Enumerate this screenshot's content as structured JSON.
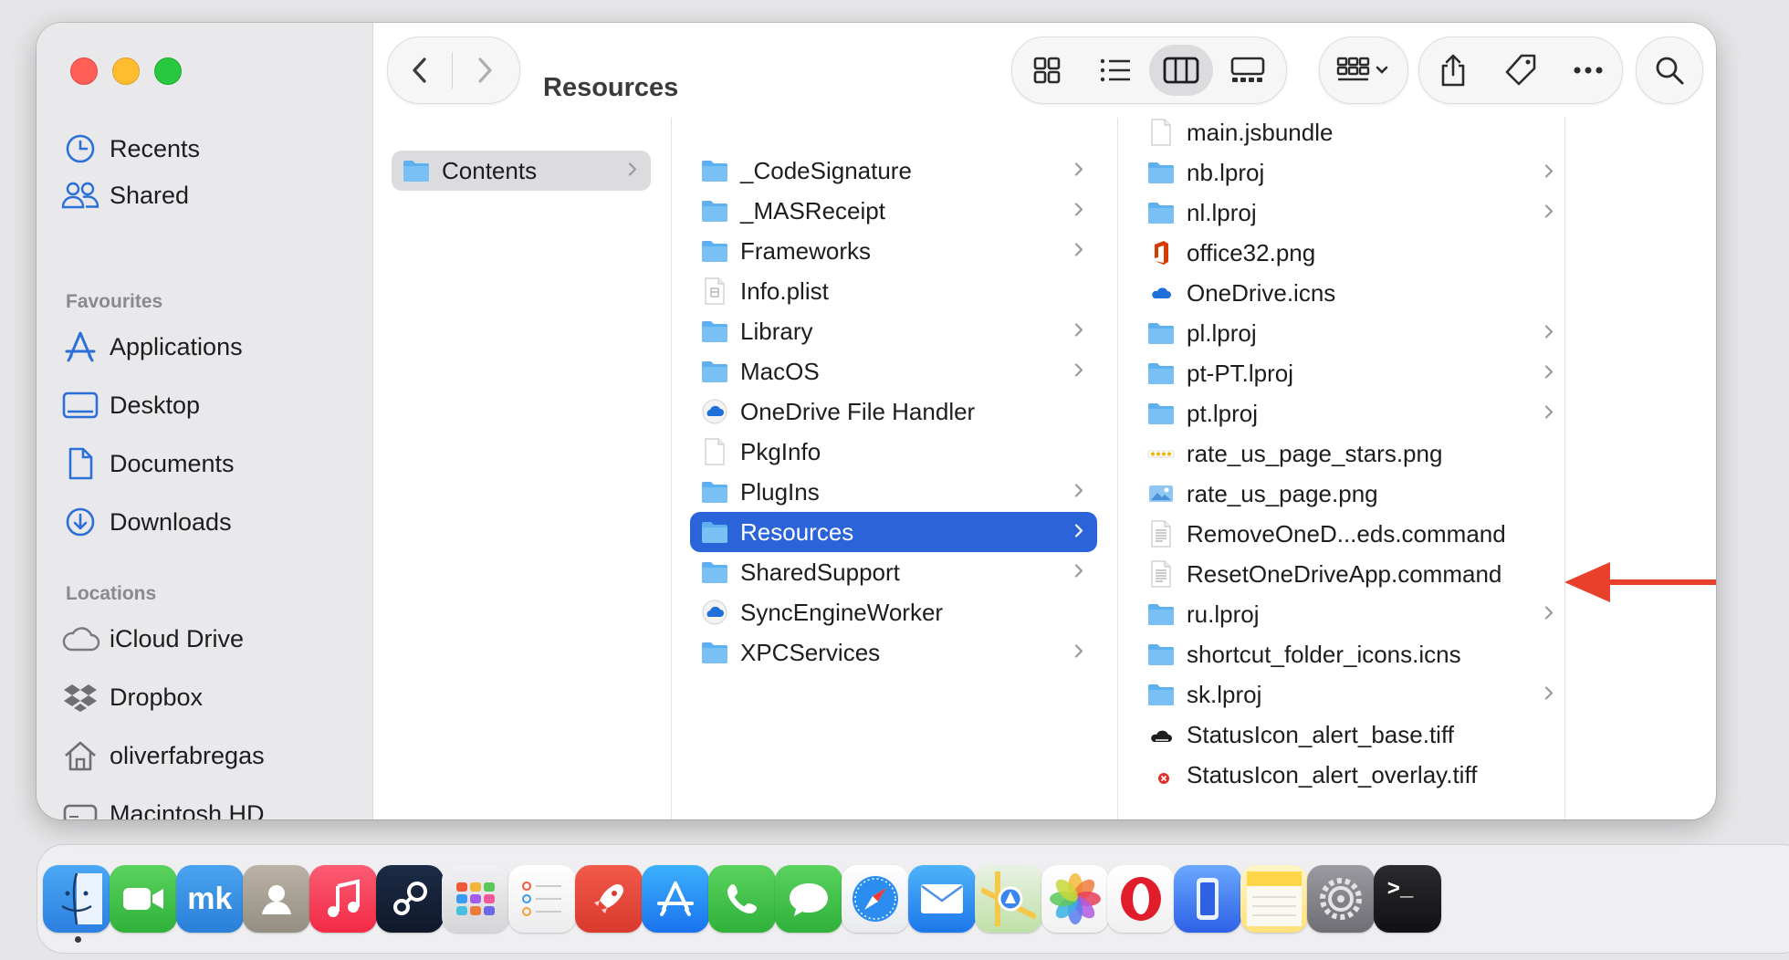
{
  "window": {
    "title": "Resources"
  },
  "sidebar": {
    "top_items": [
      {
        "label": "Recents",
        "icon": "clock-icon"
      },
      {
        "label": "Shared",
        "icon": "people-icon"
      }
    ],
    "favourites_heading": "Favourites",
    "favourites": [
      {
        "label": "Applications",
        "icon": "applications-icon"
      },
      {
        "label": "Desktop",
        "icon": "desktop-icon"
      },
      {
        "label": "Documents",
        "icon": "document-icon"
      },
      {
        "label": "Downloads",
        "icon": "download-icon"
      }
    ],
    "locations_heading": "Locations",
    "locations": [
      {
        "label": "iCloud Drive",
        "icon": "cloud-icon"
      },
      {
        "label": "Dropbox",
        "icon": "dropbox-icon"
      },
      {
        "label": "oliverfabregas",
        "icon": "home-icon"
      },
      {
        "label": "Macintosh HD",
        "icon": "drive-icon"
      }
    ]
  },
  "columns": {
    "col1": [
      {
        "name": "Contents",
        "type": "folder",
        "chevron": true
      }
    ],
    "col2": [
      {
        "name": "_CodeSignature",
        "type": "folder",
        "chevron": true
      },
      {
        "name": "_MASReceipt",
        "type": "folder",
        "chevron": true
      },
      {
        "name": "Frameworks",
        "type": "folder",
        "chevron": true
      },
      {
        "name": "Info.plist",
        "type": "plist",
        "chevron": false
      },
      {
        "name": "Library",
        "type": "folder",
        "chevron": true
      },
      {
        "name": "MacOS",
        "type": "folder",
        "chevron": true
      },
      {
        "name": "OneDrive File Handler",
        "type": "onedrive-app",
        "chevron": false
      },
      {
        "name": "PkgInfo",
        "type": "file",
        "chevron": false
      },
      {
        "name": "PlugIns",
        "type": "folder",
        "chevron": true
      },
      {
        "name": "Resources",
        "type": "folder",
        "chevron": true
      },
      {
        "name": "SharedSupport",
        "type": "folder",
        "chevron": true
      },
      {
        "name": "SyncEngineWorker",
        "type": "onedrive-app",
        "chevron": false
      },
      {
        "name": "XPCServices",
        "type": "folder",
        "chevron": true
      }
    ],
    "col3": [
      {
        "name": "main.jsbundle",
        "type": "file",
        "chevron": false
      },
      {
        "name": "nb.lproj",
        "type": "folder",
        "chevron": true
      },
      {
        "name": "nl.lproj",
        "type": "folder",
        "chevron": true
      },
      {
        "name": "office32.png",
        "type": "office",
        "chevron": false
      },
      {
        "name": "OneDrive.icns",
        "type": "onedrive-icns",
        "chevron": false
      },
      {
        "name": "pl.lproj",
        "type": "folder",
        "chevron": true
      },
      {
        "name": "pt-PT.lproj",
        "type": "folder",
        "chevron": true
      },
      {
        "name": "pt.lproj",
        "type": "folder",
        "chevron": true
      },
      {
        "name": "rate_us_page_stars.png",
        "type": "stars",
        "chevron": false
      },
      {
        "name": "rate_us_page.png",
        "type": "image",
        "chevron": false
      },
      {
        "name": "RemoveOneD...eds.command",
        "type": "script",
        "chevron": false
      },
      {
        "name": "ResetOneDriveApp.command",
        "type": "script",
        "chevron": false
      },
      {
        "name": "ru.lproj",
        "type": "folder",
        "chevron": true
      },
      {
        "name": "shortcut_folder_icons.icns",
        "type": "folder",
        "chevron": false
      },
      {
        "name": "sk.lproj",
        "type": "folder",
        "chevron": true
      },
      {
        "name": "StatusIcon_alert_base.tiff",
        "type": "status",
        "chevron": false
      },
      {
        "name": "StatusIcon_alert_overlay.tiff",
        "type": "alert",
        "chevron": false
      }
    ]
  },
  "selection": {
    "col1": "Contents",
    "col2": "Resources"
  },
  "annotation": {
    "points_to": "ResetOneDriveApp.command",
    "color": "#e8402b"
  },
  "colors": {
    "accent": "#2b63d9",
    "folder": "#5eb0ef"
  },
  "dock": [
    {
      "name": "Finder",
      "icon": "finder-icon"
    },
    {
      "name": "FaceTime",
      "icon": "facetime-icon"
    },
    {
      "name": "MindNode",
      "icon": "mk-icon"
    },
    {
      "name": "Contacts",
      "icon": "contacts-icon"
    },
    {
      "name": "Music",
      "icon": "music-icon"
    },
    {
      "name": "Steam",
      "icon": "steam-icon"
    },
    {
      "name": "Launchpad",
      "icon": "launchpad-icon"
    },
    {
      "name": "Reminders",
      "icon": "reminders-icon"
    },
    {
      "name": "Rocket",
      "icon": "rocket-icon"
    },
    {
      "name": "App Store",
      "icon": "appstore-icon"
    },
    {
      "name": "Phone",
      "icon": "phone-icon"
    },
    {
      "name": "Messages",
      "icon": "messages-icon"
    },
    {
      "name": "Safari",
      "icon": "safari-icon"
    },
    {
      "name": "Mail",
      "icon": "mail-icon"
    },
    {
      "name": "Maps",
      "icon": "maps-icon"
    },
    {
      "name": "Photos",
      "icon": "photos-icon"
    },
    {
      "name": "Opera",
      "icon": "opera-icon"
    },
    {
      "name": "iPhone Mirroring",
      "icon": "iphone-mirroring-icon"
    },
    {
      "name": "Notes",
      "icon": "notes-icon"
    },
    {
      "name": "System Settings",
      "icon": "settings-icon"
    },
    {
      "name": "Terminal",
      "icon": "terminal-icon"
    }
  ]
}
